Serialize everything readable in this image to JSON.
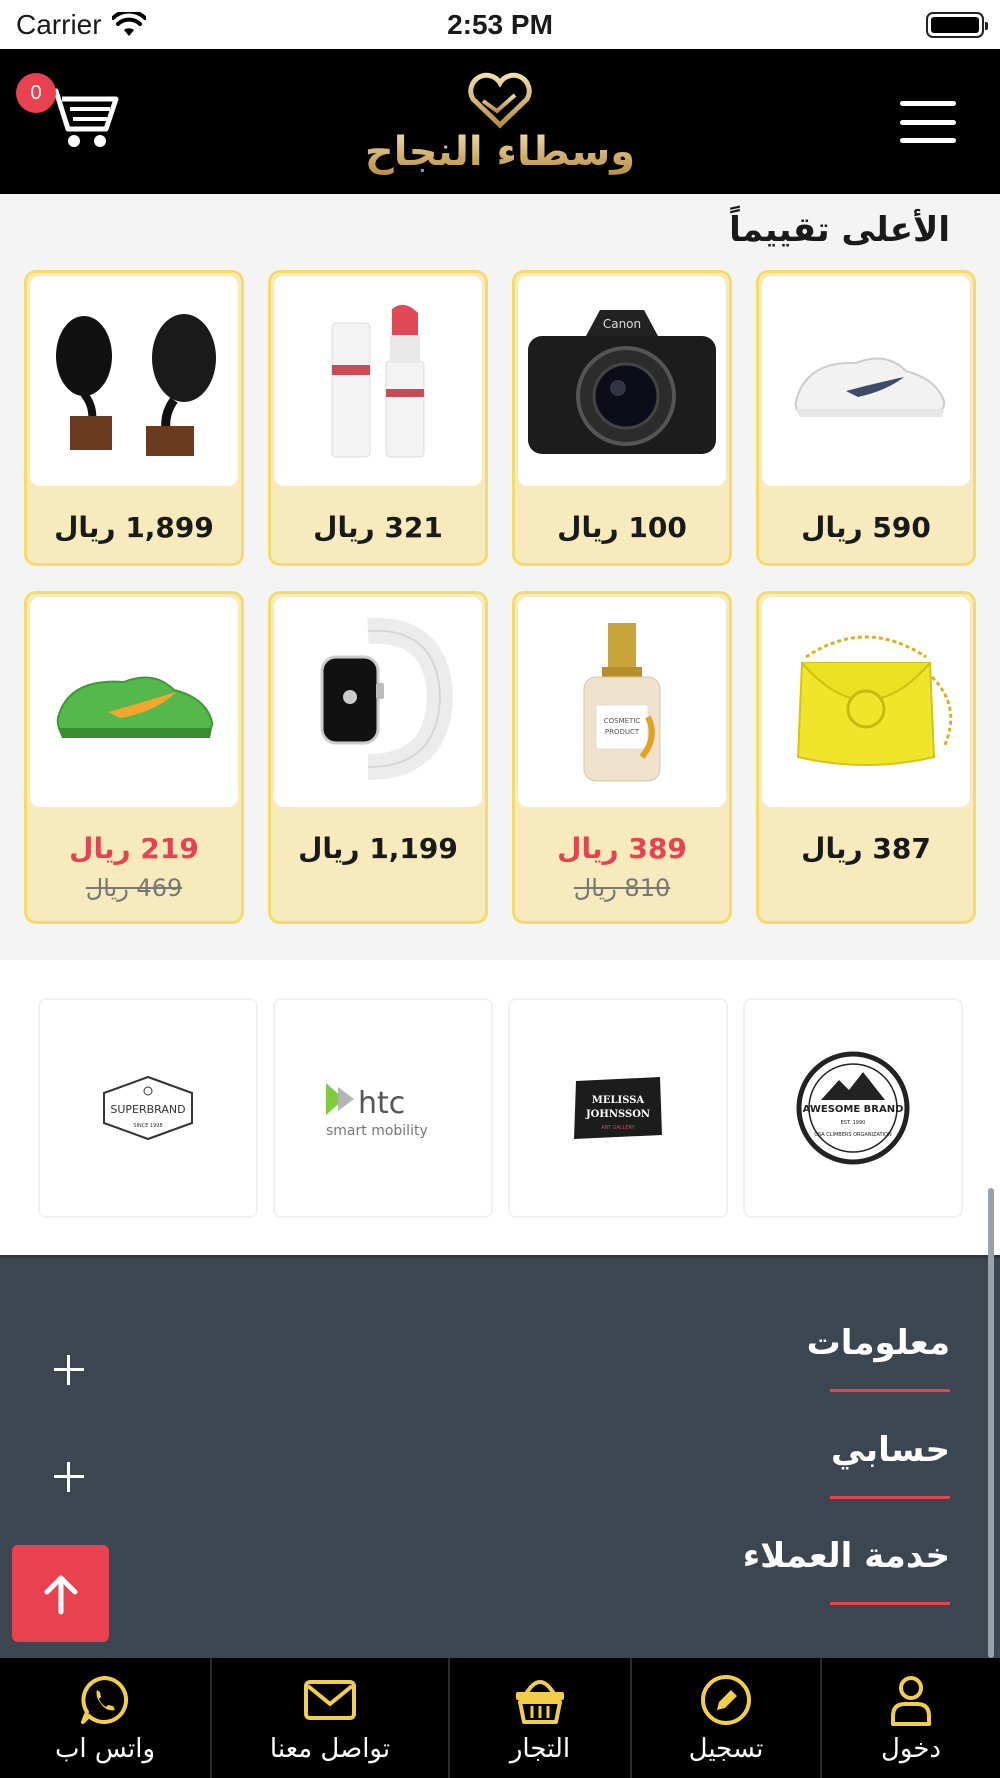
{
  "status_bar": {
    "carrier": "Carrier",
    "time": "2:53 PM"
  },
  "header": {
    "cart_count": "0",
    "logo_text": "وسطاء النجاح"
  },
  "top_rated": {
    "title": "الأعلى تقييماً",
    "products": [
      {
        "image": "white-sneaker",
        "price": "590 ريال"
      },
      {
        "image": "dslr-camera",
        "price": "100 ريال"
      },
      {
        "image": "lipstick",
        "price": "321 ريال"
      },
      {
        "image": "gramophone-speakers",
        "price": "1,899 ريال"
      },
      {
        "image": "yellow-handbag",
        "price": "387 ريال"
      },
      {
        "image": "perfume-bottle",
        "price": "389 ريال",
        "old_price": "810 ريال"
      },
      {
        "image": "smart-watch",
        "price": "1,199 ريال"
      },
      {
        "image": "green-sneaker",
        "price": "219 ريال",
        "old_price": "469 ريال"
      }
    ]
  },
  "brands": [
    {
      "name": "AWESOME BRAND",
      "sub": "USA CLIMBERS ORGANIZATION",
      "est": "EST. 1990"
    },
    {
      "name": "MELISSA JOHNSSON",
      "sub": "ART GALLERY"
    },
    {
      "name": "htc",
      "sub": "smart mobility"
    },
    {
      "name": "SUPERBRAND",
      "sub": "SINCE 1998"
    }
  ],
  "footer": {
    "sections": [
      {
        "label": "معلومات"
      },
      {
        "label": "حسابي"
      },
      {
        "label": "خدمة العملاء"
      }
    ]
  },
  "tabbar": {
    "tabs": [
      {
        "label": "دخول",
        "icon": "user-icon"
      },
      {
        "label": "تسجيل",
        "icon": "pencil-icon"
      },
      {
        "label": "التجار",
        "icon": "basket-icon"
      },
      {
        "label": "تواصل معنا",
        "icon": "mail-icon"
      },
      {
        "label": "واتس اب",
        "icon": "whatsapp-icon"
      }
    ]
  },
  "colors": {
    "accent": "#e8414f",
    "gold": "#f5dc6a",
    "card_bg": "#f7ebbd",
    "footer_bg": "#3c4650",
    "header_bg": "#000000"
  }
}
